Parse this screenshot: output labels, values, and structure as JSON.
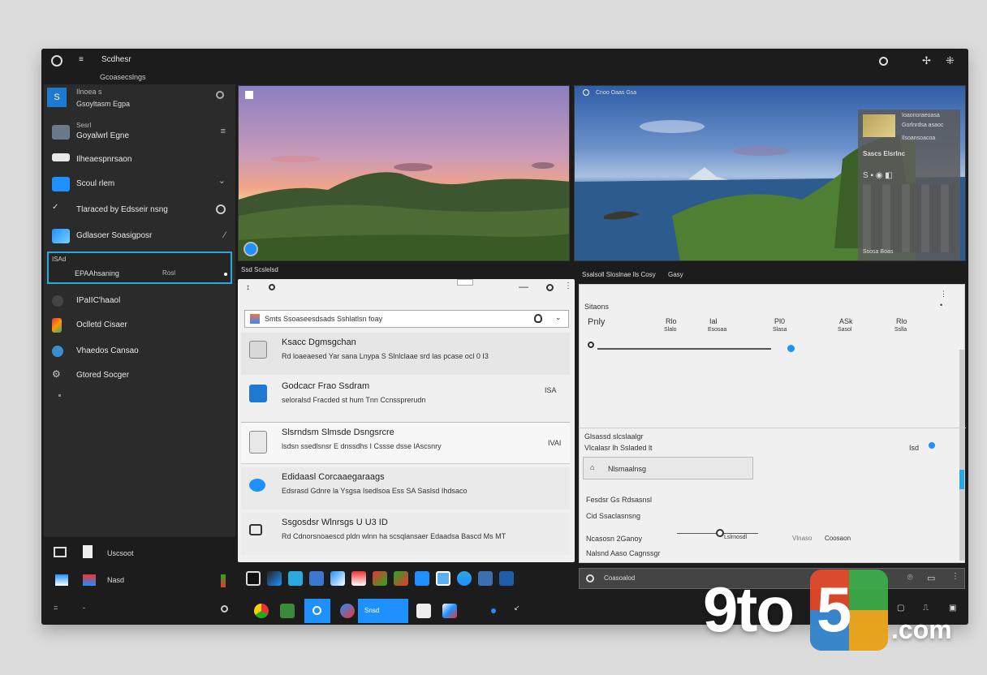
{
  "window": {
    "title": "Scdhesr",
    "subtitle": "Gcoasecslngs"
  },
  "sidebar": {
    "account_line1": "Ilnoea s",
    "account_line2": "Gsoyltasm Egpa",
    "items": [
      {
        "label": "Sesrl",
        "sub": "Goyalwrl Egne"
      },
      {
        "label": "Ilheaespnrsaon"
      },
      {
        "label": "Scoul rlem"
      },
      {
        "label": "Tlaraced by Edsseir nsng"
      },
      {
        "label": "Gdlasoer Soasigposr"
      },
      {
        "label": "EPAAhsaning",
        "sub": "ISAd",
        "tag": "Rosl"
      },
      {
        "label": "IPaIIC'haaol"
      },
      {
        "label": "Oclletd Cisaer"
      },
      {
        "label": "Vhaedos Cansao"
      },
      {
        "label": "Gtored Socger"
      }
    ],
    "footer_label": "Uscsoot",
    "footer2_label": "Nasd"
  },
  "panes": {
    "top_left_caption": "Ssd Scslelsd",
    "top_right_header": "Cnoo Oaas Gsa",
    "right_caption": "Ssalsoll Sloslnae lls Cosy",
    "right_caption2": "Gasy"
  },
  "overlay_card": {
    "line1": "Ioaonoraeoasa",
    "line2": "Gorlnrdsa asaoc",
    "line3": "Ilsoansoacoa",
    "value": "Sascs Elsrlnc",
    "sub_value": "Ssosa Boas"
  },
  "list_pane": {
    "search_placeholder": "Smts Ssoaseesdsads Sshlatlsn foay",
    "items": [
      {
        "title": "Ksacc Dgmsgchan",
        "sub": "Rd loaeaesed Yar sana Lnypa S Slnlclaae srd las pcase ocl 0 I3"
      },
      {
        "title": "Godcacr Frao Ssdram",
        "sub": "seloralsd Fracded st hum Tnn Ccnssprerudn",
        "badge": "ISA"
      },
      {
        "title": "Slsrndsm Slmsde Dsngsrcre",
        "sub": "lsdsn ssedlsnsr E dnssdhs I Cssse dsse lAscsnry",
        "badge": "IVAI"
      },
      {
        "title": "Edidaasl Corcaaegaraags",
        "sub": "Edsrasd Gdnre la Ysgsa Isedlsoa Ess SA Saslsd Ihdsaco"
      },
      {
        "title": "Ssgosdsr Wlnrsgs U U3 ID",
        "sub": "Rd Cdnorsnoaescd pldn wlnn ha scsqlansaer Edaadsa Bascd Ms MT"
      }
    ]
  },
  "settings_pane": {
    "header": "Sitaons",
    "row_label": "Pnly",
    "columns": [
      "Rlo",
      "Ial",
      "Pl0",
      "ASk",
      "Rlo"
    ],
    "column_subs": [
      "Slalo",
      "Esosaa",
      "Slasa",
      "Sasol",
      "Sslla"
    ],
    "section_title": "Glsassd slcslaalgr",
    "section_sub": "Vlcalasr lh Ssladed lt",
    "section_badge": "Isd",
    "field_value": "Nlsmaalnsg",
    "label_a": "Fesdsr Gs Rdsasnsl",
    "label_b": "Cid Ssaclasnsng",
    "slider_label": "Ncasosn 2Ganoy",
    "slider_value": "Lslrnosdl",
    "slider_aux": "Vlnaso",
    "slider_aux2": "Coosaon",
    "label_c": "Nalsnd Aaso Cagnssgr"
  },
  "bottom_search": {
    "placeholder": "Coasoalod"
  },
  "taskbar": {
    "start_label": "Snsd"
  },
  "watermark": {
    "brand": "9to5",
    "domain": ".com"
  },
  "colors": {
    "accent": "#1e90ff",
    "highlight": "#2aa9e0",
    "dark_bg": "#1c1c1c",
    "sidebar_bg": "#2b2b2b"
  }
}
